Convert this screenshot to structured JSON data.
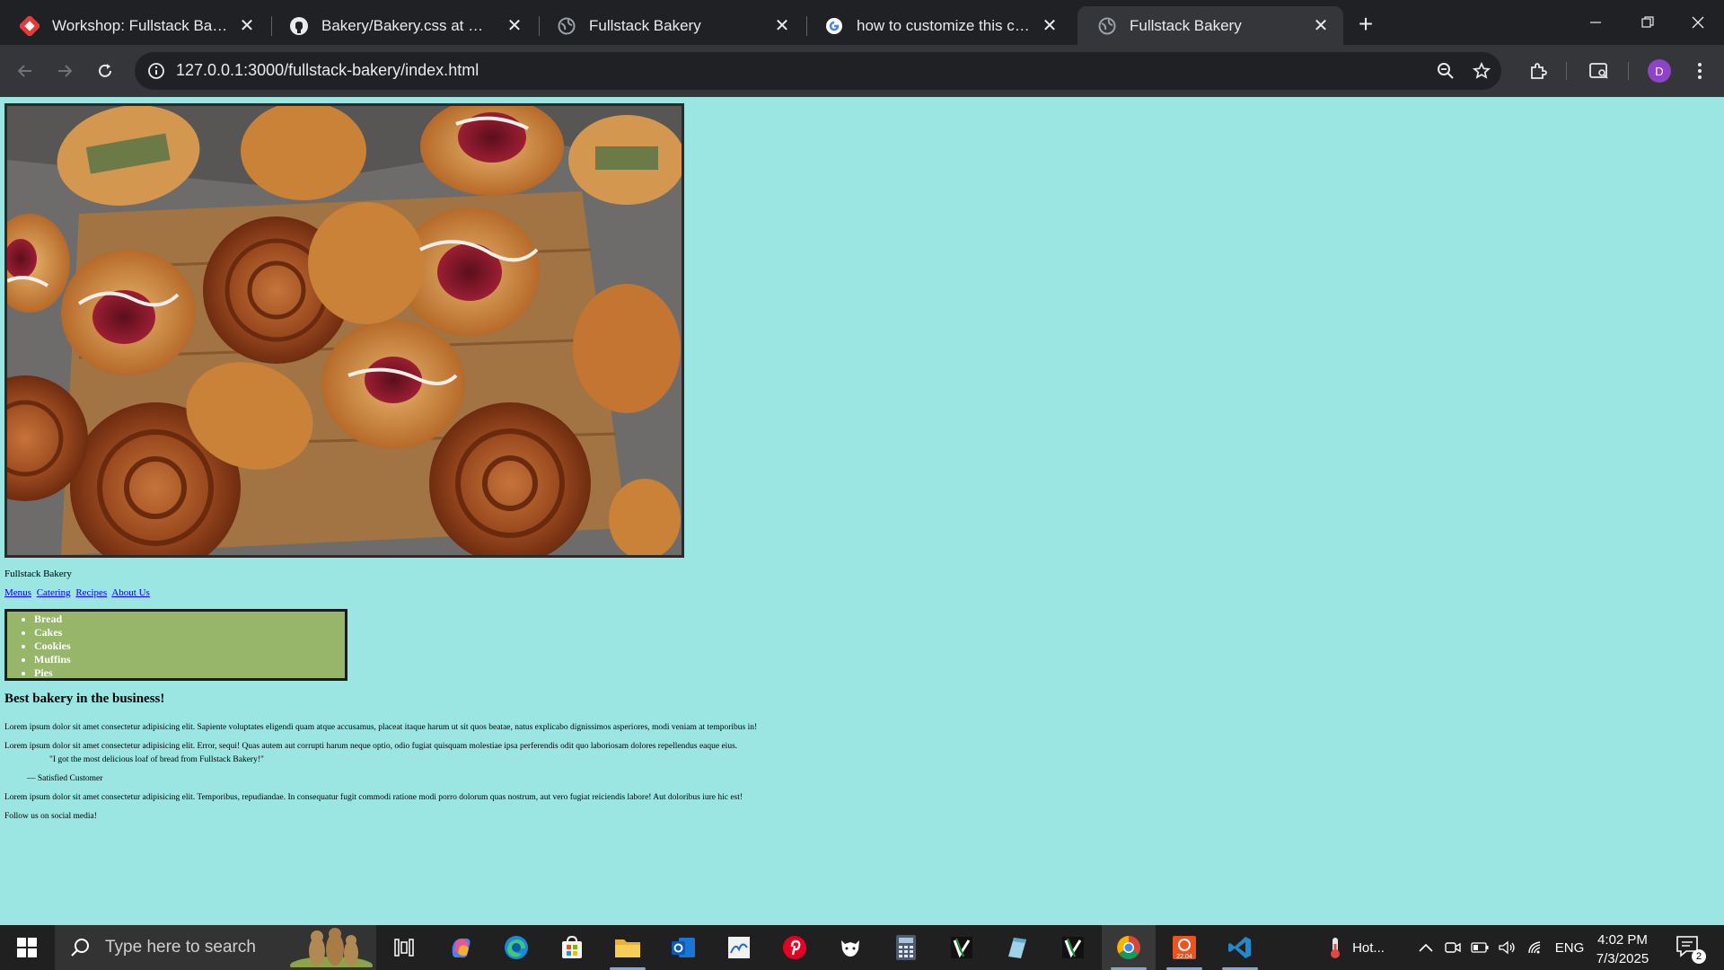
{
  "browser": {
    "tabs": [
      {
        "title": "Workshop: Fullstack Bakery",
        "icon": "fullstack-logo-icon",
        "active": false
      },
      {
        "title": "Bakery/Bakery.css at main · Dec",
        "icon": "github-icon",
        "active": false
      },
      {
        "title": "Fullstack Bakery",
        "icon": "globe-icon",
        "active": false
      },
      {
        "title": "how to customize this code in c",
        "icon": "google-icon",
        "active": false
      },
      {
        "title": "Fullstack Bakery",
        "icon": "globe-icon",
        "active": true
      }
    ],
    "address": "127.0.0.1:3000/fullstack-bakery/index.html",
    "profile_initial": "D",
    "theme": {
      "frame": "#202124",
      "toolbar": "#35363a",
      "text": "#e8eaed"
    }
  },
  "page": {
    "background": "#9be5e3",
    "hero_image": "pastries-on-wooden-board",
    "site_name": "Fullstack Bakery",
    "nav": [
      "Menus",
      "Catering",
      "Recipes",
      "About Us"
    ],
    "categories": [
      "Bread",
      "Cakes",
      "Cookies",
      "Muffins",
      "Pies"
    ],
    "category_box_color": "#97b66a",
    "headline": "Best bakery in the business!",
    "paragraph_1": "Lorem ipsum dolor sit amet consectetur adipisicing elit. Sapiente voluptates eligendi quam atque accusamus, placeat itaque harum ut sit quos beatae, natus explicabo dignissimos asperiores, modi veniam at temporibus in!",
    "paragraph_2": "Lorem ipsum dolor sit amet consectetur adipisicing elit. Error, sequi! Quas autem aut corrupti harum neque optio, odio fugiat quisquam molestiae ipsa perferendis odit quo laboriosam dolores repellendus eaque eius.",
    "quote": "\"I got the most delicious loaf of bread from Fullstack Bakery!\"",
    "quote_cite": "— Satisfied Customer",
    "paragraph_3": "Lorem ipsum dolor sit amet consectetur adipisicing elit. Temporibus, repudiandae. In consequatur fugit commodi ratione modi porro dolorum quas nostrum, aut vero fugiat reiciendis labore! Aut doloribus iure hic est!",
    "social": "Follow us on social media!"
  },
  "taskbar": {
    "search_placeholder": "Type here to search",
    "apps": [
      "task-view-icon",
      "copilot-icon",
      "edge-icon",
      "store-icon",
      "file-explorer-icon",
      "outlook-icon",
      "photos-icon",
      "pinterest-icon",
      "github-desktop-icon",
      "calculator-icon",
      "vim-icon",
      "notepad-icon",
      "vim-icon",
      "chrome-icon",
      "ubuntu-icon",
      "vscode-icon"
    ],
    "weather": "Hot...",
    "language": "ENG",
    "time": "4:02 PM",
    "date": "7/3/2025",
    "notifications": "2"
  }
}
